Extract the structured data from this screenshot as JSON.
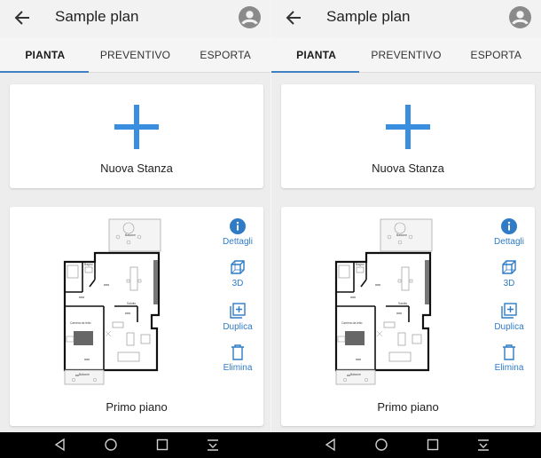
{
  "screens": [
    {
      "title": "Sample plan",
      "tabs": [
        "PIANTA",
        "PREVENTIVO",
        "ESPORTA"
      ],
      "new_room_label": "Nuova Stanza",
      "plan_name": "Primo piano",
      "actions": [
        "Dettagli",
        "3D",
        "Duplica",
        "Elimina"
      ]
    },
    {
      "title": "Sample plan",
      "tabs": [
        "PIANTA",
        "PREVENTIVO",
        "ESPORTA"
      ],
      "new_room_label": "Nuova Stanza",
      "plan_name": "Primo piano",
      "actions": [
        "Dettagli",
        "3D",
        "Duplica",
        "Elimina"
      ]
    }
  ],
  "plan_room_labels": [
    "Bagno",
    "Balcone",
    "Salotto",
    "Camera da letto",
    "Balcone"
  ],
  "colors": {
    "accent": "#3a8ee0",
    "action_text": "#2f7bc5",
    "tab_indicator": "#3f7fc4"
  },
  "icons": [
    "back-arrow-icon",
    "account-circle-icon",
    "plus-icon",
    "info-icon",
    "cube-3d-icon",
    "duplicate-icon",
    "trash-icon",
    "nav-back-icon",
    "nav-home-icon",
    "nav-recents-icon",
    "nav-menu-icon"
  ]
}
